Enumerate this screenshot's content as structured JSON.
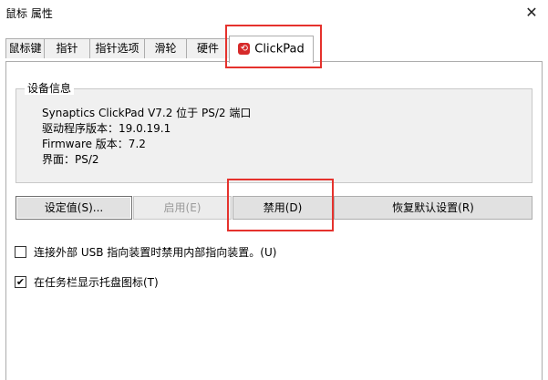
{
  "window": {
    "title": "鼠标 属性",
    "close_glyph": "✕"
  },
  "tabs": [
    {
      "label": "鼠标键"
    },
    {
      "label": "指针"
    },
    {
      "label": "指针选项"
    },
    {
      "label": "滑轮"
    },
    {
      "label": "硬件"
    },
    {
      "label": "ClickPad",
      "active": true
    }
  ],
  "device_info": {
    "title": "设备信息",
    "lines": [
      "Synaptics ClickPad V7.2 位于 PS/2 端口",
      "驱动程序版本：19.0.19.1",
      "Firmware 版本：7.2",
      "界面：PS/2"
    ]
  },
  "buttons": {
    "settings": "设定值(S)...",
    "enable": "启用(E)",
    "disable": "禁用(D)",
    "restore_defaults": "恢复默认设置(R)"
  },
  "options": {
    "disable_internal": {
      "label": "连接外部 USB 指向装置时禁用内部指向装置。(U)",
      "checked": false
    },
    "tray_icon": {
      "label": "在任务栏显示托盘图标(T)",
      "checked": true
    }
  },
  "highlight_color": "#e5322d"
}
